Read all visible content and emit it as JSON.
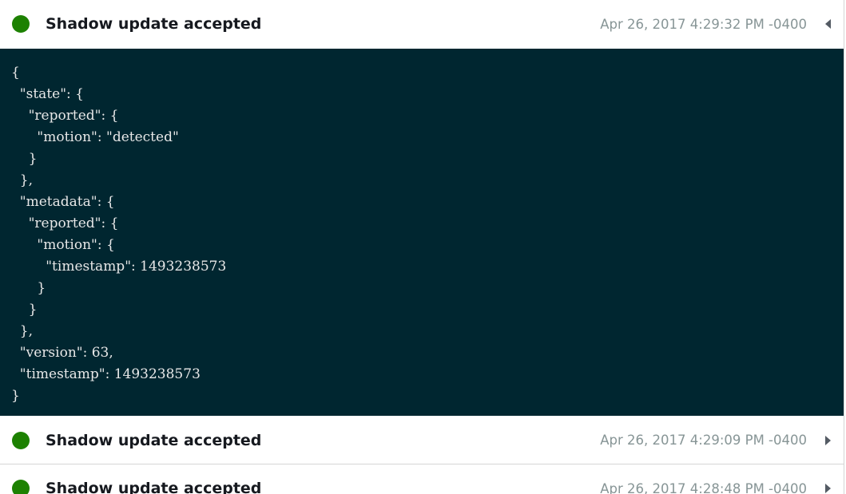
{
  "events": [
    {
      "title": "Shadow update accepted",
      "timestamp": "Apr 26, 2017 4:29:32 PM -0400",
      "expanded": true,
      "caret_icon": "caret-left-icon",
      "status_color": "#1d8102",
      "payload": "{\n  \"state\": {\n    \"reported\": {\n      \"motion\": \"detected\"\n    }\n  },\n  \"metadata\": {\n    \"reported\": {\n      \"motion\": {\n        \"timestamp\": 1493238573\n      }\n    }\n  },\n  \"version\": 63,\n  \"timestamp\": 1493238573\n}"
    },
    {
      "title": "Shadow update accepted",
      "timestamp": "Apr 26, 2017 4:29:09 PM -0400",
      "expanded": false,
      "caret_icon": "caret-right-icon",
      "status_color": "#1d8102"
    },
    {
      "title": "Shadow update accepted",
      "timestamp": "Apr 26, 2017 4:28:48 PM -0400",
      "expanded": false,
      "caret_icon": "caret-right-icon",
      "status_color": "#1d8102"
    }
  ],
  "colors": {
    "payload_background": "#002630",
    "status_success": "#1d8102",
    "timestamp_text": "#879596"
  }
}
